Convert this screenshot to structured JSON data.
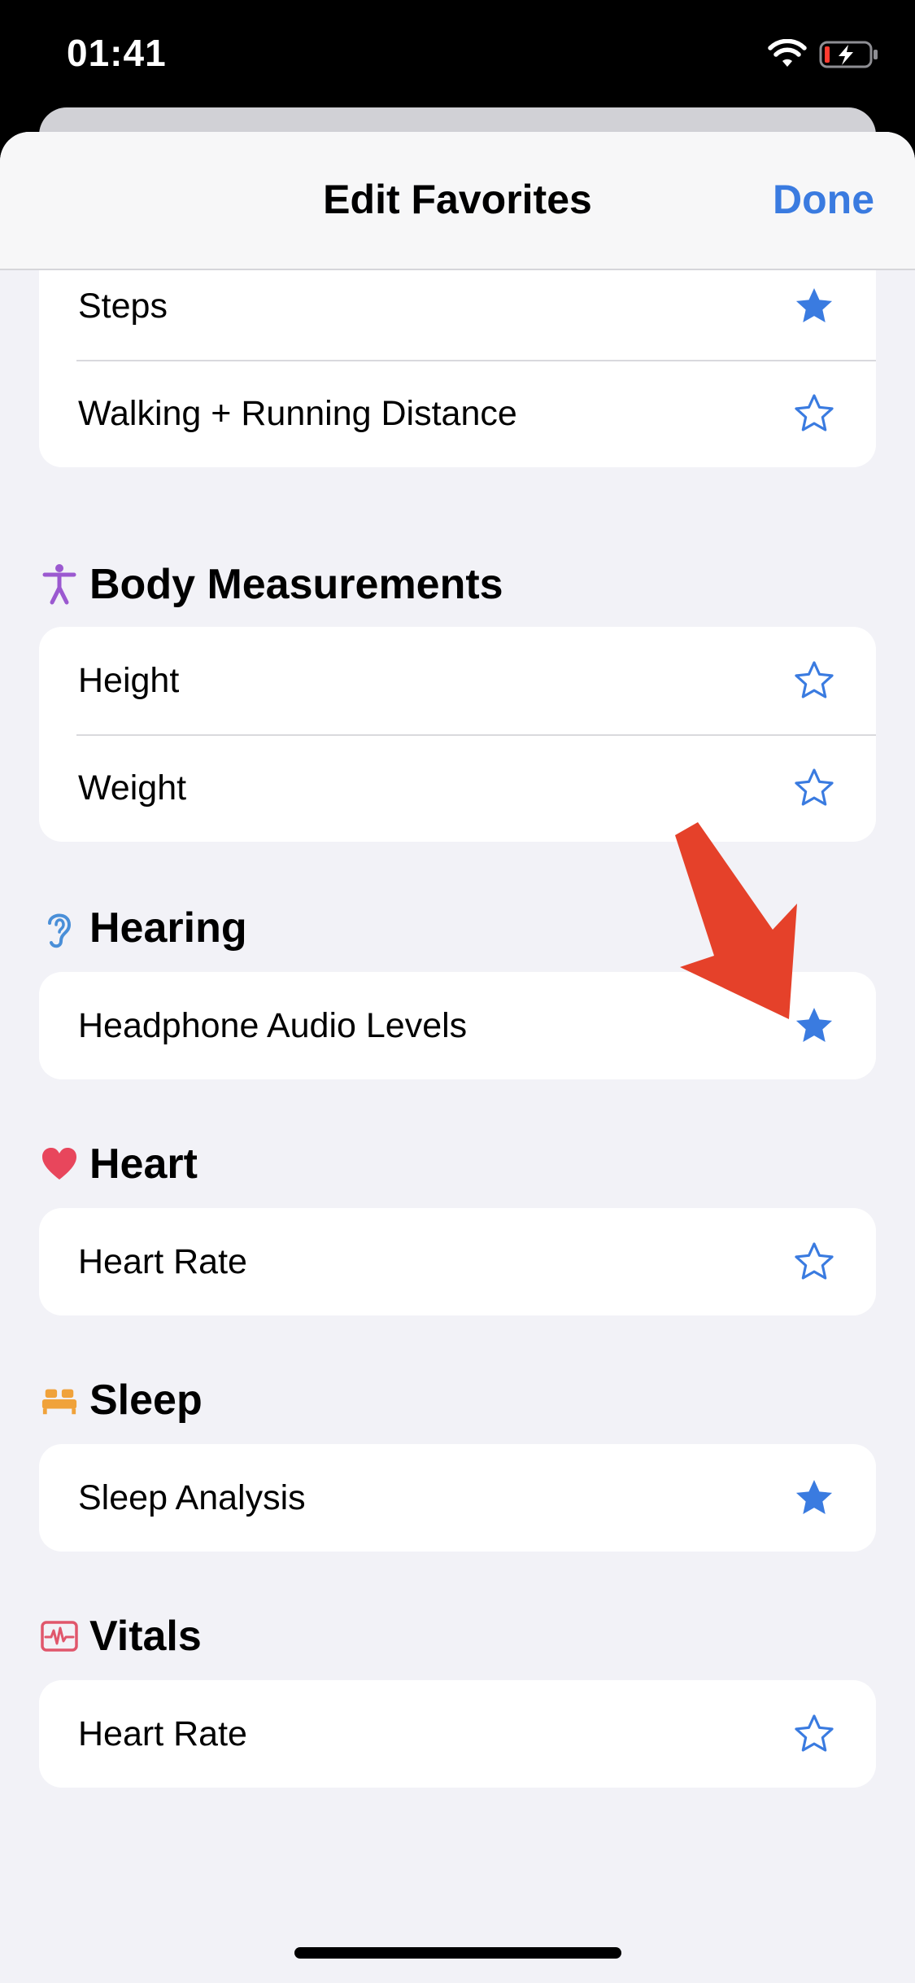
{
  "status_bar": {
    "time": "01:41"
  },
  "nav": {
    "title": "Edit Favorites",
    "done_label": "Done"
  },
  "colors": {
    "accent": "#3a7be0",
    "star": "#3a7be0",
    "arrow": "#e5412a",
    "body_measurements_icon": "#9b59d0",
    "hearing_icon": "#4a8fd8",
    "heart_icon": "#e8465c",
    "sleep_icon": "#f0a23a",
    "vitals_icon": "#e0566b"
  },
  "top_group": {
    "rows": [
      {
        "label": "Steps",
        "favorited": true
      },
      {
        "label": "Walking + Running Distance",
        "favorited": false
      }
    ]
  },
  "sections": [
    {
      "title": "Body Measurements",
      "icon": "figure-icon",
      "rows": [
        {
          "label": "Height",
          "favorited": false
        },
        {
          "label": "Weight",
          "favorited": false
        }
      ]
    },
    {
      "title": "Hearing",
      "icon": "ear-icon",
      "rows": [
        {
          "label": "Headphone Audio Levels",
          "favorited": true
        }
      ]
    },
    {
      "title": "Heart",
      "icon": "heart-icon",
      "rows": [
        {
          "label": "Heart Rate",
          "favorited": false
        }
      ]
    },
    {
      "title": "Sleep",
      "icon": "bed-icon",
      "rows": [
        {
          "label": "Sleep Analysis",
          "favorited": true
        }
      ]
    },
    {
      "title": "Vitals",
      "icon": "vitals-icon",
      "rows": [
        {
          "label": "Heart Rate",
          "favorited": false
        }
      ]
    }
  ]
}
